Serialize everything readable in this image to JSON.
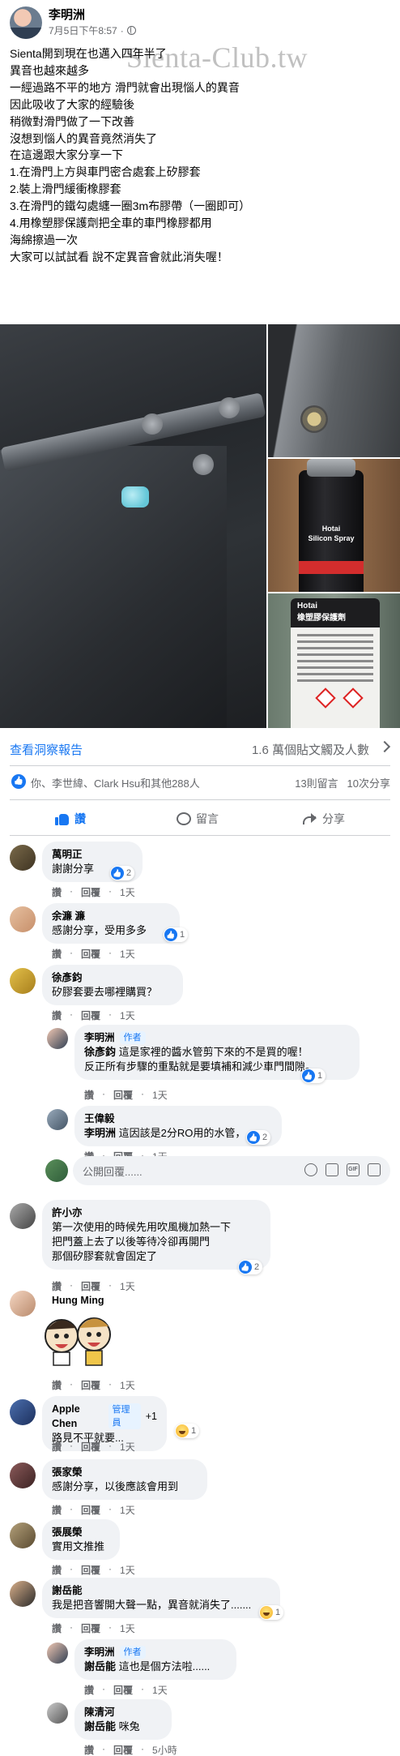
{
  "post": {
    "author": "李明洲",
    "timestamp": "7月5日下午8:57",
    "privacy_icon": "globe-icon",
    "watermark": "Sienta-Club.tw",
    "lines": [
      "Sienta開到現在也邁入四年半了",
      "異音也越來越多",
      "一經過路不平的地方 滑門就會出現惱人的異音",
      "因此吸收了大家的經驗後",
      "稍微對滑門做了一下改善",
      "沒想到惱人的異音竟然消失了",
      "在這邊跟大家分享一下",
      "1.在滑門上方與車門密合處套上矽膠套",
      "2.裝上滑門緩衝橡膠套",
      "3.在滑門的鐵勾處纏一圈3m布膠帶（一圈即可）",
      "4.用橡塑膠保護劑把全車的車門橡膠都用",
      "海綿擦過一次",
      "大家可以試試看 說不定異音會就此消失喔！"
    ],
    "photo_text": {
      "can_brand": "Hotai",
      "can_product": "Silicon Spray",
      "label_brand": "Hotai",
      "label_title": "橡塑膠保護劑"
    }
  },
  "insights": {
    "link": "查看洞察報告",
    "stats": "1.6 萬個貼文觸及人數"
  },
  "reactions": {
    "names": "你、李世緯、Clark Hsu和其他288人",
    "comments": "13則留言",
    "shares": "10次分享"
  },
  "actions": {
    "like": "讚",
    "comment": "留言",
    "share": "分享"
  },
  "meta_labels": {
    "like": "讚",
    "reply": "回覆"
  },
  "comments": [
    {
      "name": "萬明正",
      "lines": [
        "謝謝分享"
      ],
      "react": "2",
      "time": "1天"
    },
    {
      "name": "余濂 濂",
      "lines": [
        "感謝分享，受用多多"
      ],
      "react": "1",
      "time": "1天"
    },
    {
      "name": "徐彥鈞",
      "lines": [
        "矽膠套要去哪裡購買？"
      ],
      "time": "1天"
    },
    {
      "name": "李明洲",
      "role": "作者",
      "mention": "徐彥鈞",
      "lines": [
        " 這是家裡的醬水管剪下來的不是買的喔！",
        "反正所有步驟的重點就是要填補和減少車門間隙。"
      ],
      "react": "1",
      "time": "1天"
    },
    {
      "name": "王偉毅",
      "mention": "李明洲",
      "lines": [
        " 這因該是2分RO用的水管，"
      ],
      "react": "2",
      "time": "1天"
    },
    {
      "name": "許小亦",
      "lines": [
        "第一次使用的時候先用吹風機加熱一下",
        "把門蓋上去了以後等待冷卻再開門",
        "那個矽膠套就會固定了"
      ],
      "react": "2",
      "time": "1天"
    },
    {
      "name": "Hung Ming",
      "lines": [],
      "time": "1天"
    },
    {
      "name": "Apple Chen",
      "role": "管理員",
      "extra": "+1",
      "lines": [
        "路見不平就要..."
      ],
      "react": "1",
      "time": "1天"
    },
    {
      "name": "張家榮",
      "lines": [
        "感謝分享，以後應該會用到"
      ],
      "time": "1天"
    },
    {
      "name": "張展榮",
      "lines": [
        "實用文推推"
      ],
      "time": "1天"
    },
    {
      "name": "謝岳能",
      "lines": [
        "我是把音響開大聲一點，異音就消失了......."
      ],
      "react": "1",
      "time": "1天"
    },
    {
      "name": "李明洲",
      "role": "作者",
      "mention": "謝岳能",
      "lines": [
        " 這也是個方法啦......"
      ],
      "time": "1天"
    },
    {
      "name": "陳清河",
      "mention": "謝岳能",
      "lines": [
        " 咪兔"
      ],
      "time": "5小時"
    }
  ],
  "reply_box": {
    "placeholder": "公開回覆......"
  },
  "colors": {
    "accent": "#1877f2",
    "bubble": "#f0f2f5",
    "muted": "#65676b"
  }
}
